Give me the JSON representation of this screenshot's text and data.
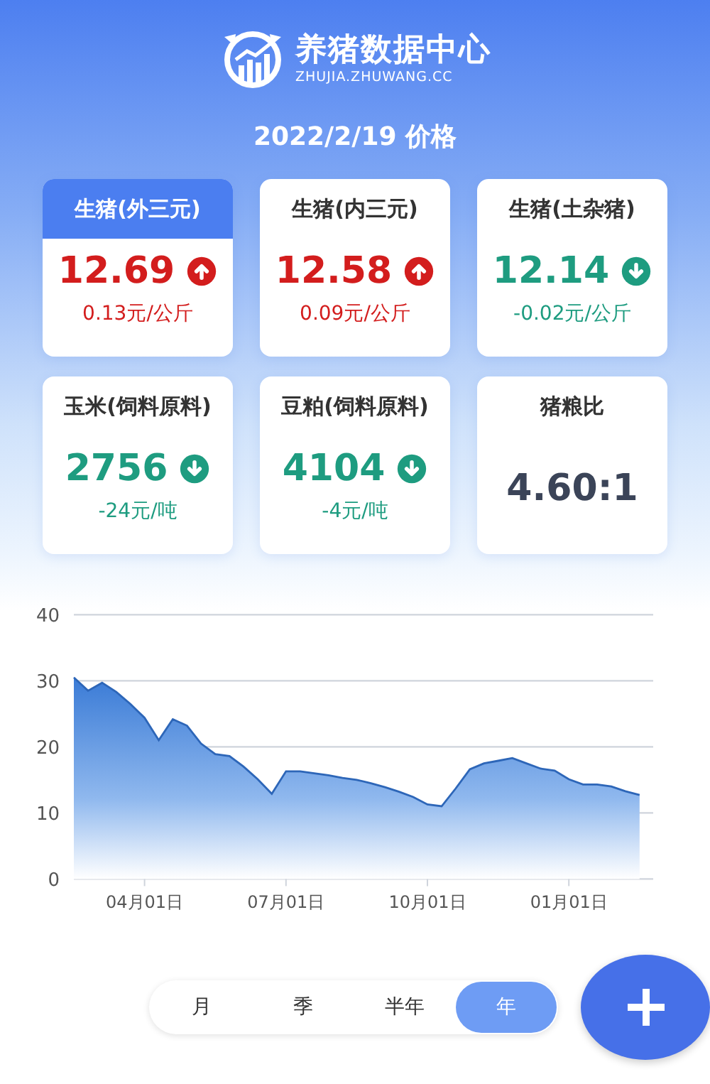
{
  "header": {
    "title": "养猪数据中心",
    "subtitle": "ZHUJIA.ZHUWANG.CC"
  },
  "date_heading": "2022/2/19 价格",
  "cards": [
    {
      "kind": "price",
      "name": "生猪(外三元)",
      "selected": true,
      "value": "12.69",
      "rising": true,
      "change": "0.13元/公斤"
    },
    {
      "kind": "price",
      "name": "生猪(内三元)",
      "selected": false,
      "value": "12.58",
      "rising": true,
      "change": "0.09元/公斤"
    },
    {
      "kind": "price",
      "name": "生猪(土杂猪)",
      "selected": false,
      "value": "12.14",
      "rising": false,
      "change": "-0.02元/公斤"
    },
    {
      "kind": "price",
      "name": "玉米(饲料原料)",
      "selected": false,
      "value": "2756",
      "rising": false,
      "change": "-24元/吨"
    },
    {
      "kind": "price",
      "name": "豆粕(饲料原料)",
      "selected": false,
      "value": "4104",
      "rising": false,
      "change": "-4元/吨"
    },
    {
      "kind": "ratio",
      "name": "猪粮比",
      "selected": false,
      "value": "4.60:1"
    }
  ],
  "chart": {
    "chart_data": {
      "type": "area",
      "categories": [
        null,
        null,
        null,
        null,
        null,
        "04月01日",
        null,
        null,
        null,
        null,
        null,
        null,
        null,
        null,
        null,
        "07月01日",
        null,
        null,
        null,
        null,
        null,
        null,
        null,
        null,
        null,
        "10月01日",
        null,
        null,
        null,
        null,
        null,
        null,
        null,
        null,
        null,
        "01月01日",
        null,
        null,
        null,
        null,
        null
      ],
      "values": [
        30.5,
        28.5,
        29.7,
        28.3,
        26.5,
        24.4,
        21,
        24.2,
        23.2,
        20.5,
        18.9,
        18.6,
        17,
        15.1,
        12.9,
        16.3,
        16.3,
        16,
        15.7,
        15.3,
        15,
        14.5,
        13.9,
        13.2,
        12.4,
        11.3,
        11,
        13.7,
        16.6,
        17.5,
        17.9,
        18.3,
        17.5,
        16.7,
        16.4,
        15.1,
        14.3,
        14.3,
        14,
        13.3,
        12.7
      ],
      "ylim": [
        0,
        40
      ],
      "grid": true,
      "yticks": [
        0,
        10,
        20,
        30,
        40
      ]
    }
  },
  "periods": [
    {
      "label": "月",
      "selected": false
    },
    {
      "label": "季",
      "selected": false
    },
    {
      "label": "半年",
      "selected": false
    },
    {
      "label": "年",
      "selected": true
    }
  ]
}
